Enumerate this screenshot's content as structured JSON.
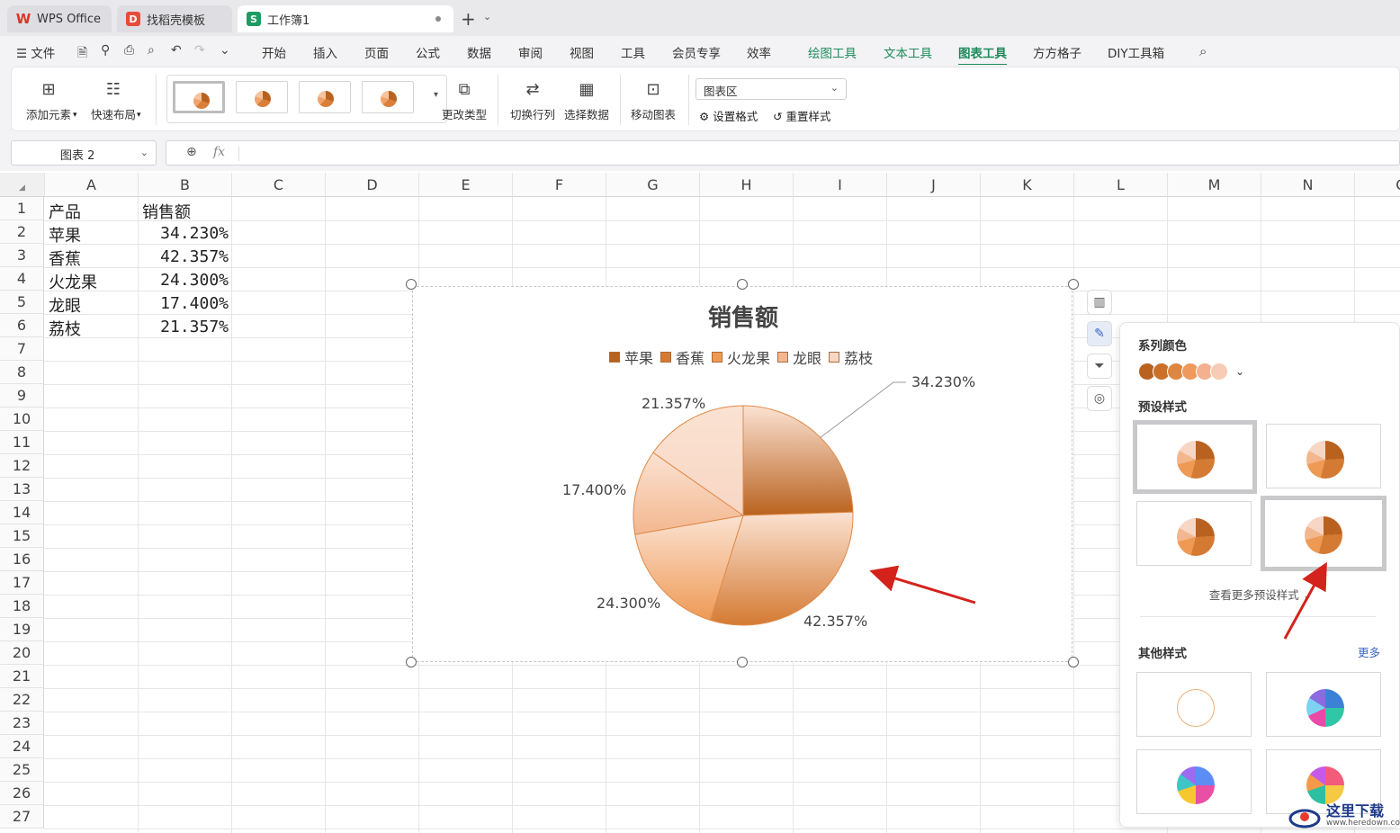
{
  "tabs": [
    {
      "label": "WPS Office"
    },
    {
      "label": "找稻壳模板"
    },
    {
      "label": "工作簿1"
    }
  ],
  "menu": {
    "file": "文件",
    "items": [
      "开始",
      "插入",
      "页面",
      "公式",
      "数据",
      "审阅",
      "视图",
      "工具",
      "会员专享",
      "效率",
      "绘图工具",
      "文本工具",
      "图表工具",
      "方方格子",
      "DIY工具箱"
    ]
  },
  "ribbon": {
    "add_element": "添加元素",
    "quick_layout": "快速布局",
    "change_type": "更改类型",
    "switch_row_col": "切换行列",
    "select_data": "选择数据",
    "move_chart": "移动图表",
    "chart_area_select": "图表区",
    "set_format": "设置格式",
    "reset_style": "重置样式"
  },
  "formula_bar": {
    "name_box": "图表 2",
    "fx": "fx"
  },
  "sheet": {
    "columns": [
      "A",
      "B",
      "C",
      "D",
      "E",
      "F",
      "G",
      "H",
      "I",
      "J",
      "K",
      "L",
      "M",
      "N",
      "O"
    ],
    "rows": [
      "1",
      "2",
      "3",
      "4",
      "5",
      "6",
      "7",
      "8",
      "9",
      "10",
      "11",
      "12",
      "13",
      "14",
      "15",
      "16",
      "17",
      "18",
      "19",
      "20",
      "21",
      "22",
      "23",
      "24",
      "25",
      "26",
      "27"
    ],
    "header": [
      "产品",
      "销售额"
    ],
    "data": [
      [
        "苹果",
        "34.230%"
      ],
      [
        "香蕉",
        "42.357%"
      ],
      [
        "火龙果",
        "24.300%"
      ],
      [
        "龙眼",
        "17.400%"
      ],
      [
        "荔枝",
        "21.357%"
      ]
    ]
  },
  "chart_data": {
    "type": "pie",
    "title": "销售额",
    "categories": [
      "苹果",
      "香蕉",
      "火龙果",
      "龙眼",
      "荔枝"
    ],
    "values": [
      34.23,
      42.357,
      24.3,
      17.4,
      21.357
    ],
    "labels": [
      "34.230%",
      "42.357%",
      "24.300%",
      "17.400%",
      "21.357%"
    ],
    "colors": [
      "#b9621f",
      "#d47a33",
      "#ee9a55",
      "#f3b78f",
      "#f8d6c4"
    ],
    "legend_position": "top"
  },
  "panel": {
    "series_color": "系列颜色",
    "preset_style": "预设样式",
    "more_presets": "查看更多预设样式",
    "other_style": "其他样式",
    "more": "更多",
    "swatch_colors": [
      "#b9621f",
      "#c9702a",
      "#dd8640",
      "#ee9a5c",
      "#f3b190",
      "#f7cbb5"
    ]
  },
  "watermark": {
    "text": "这里下载",
    "url": "www.heredown.com"
  }
}
